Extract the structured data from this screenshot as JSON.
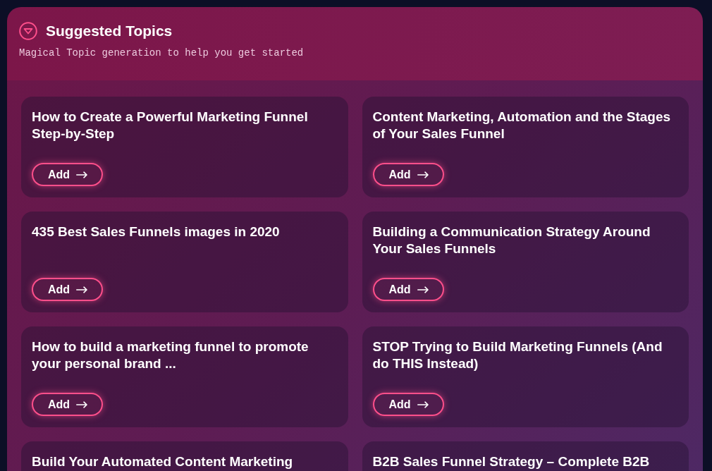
{
  "header": {
    "title": "Suggested Topics",
    "subtitle": "Magical Topic generation to help you get started"
  },
  "topics": [
    {
      "title": "How to Create a Powerful Marketing Funnel Step-by-Step",
      "button": "Add"
    },
    {
      "title": "Content Marketing, Automation and the Stages of Your Sales Funnel",
      "button": "Add"
    },
    {
      "title": "435 Best Sales Funnels images in 2020",
      "button": "Add"
    },
    {
      "title": "Building a Communication Strategy Around Your Sales Funnels",
      "button": "Add"
    },
    {
      "title": "How to build a marketing funnel to promote your personal brand ...",
      "button": "Add"
    },
    {
      "title": "STOP Trying to Build Marketing Funnels (And do THIS Instead)",
      "button": "Add"
    },
    {
      "title": "Build Your Automated Content Marketing"
    },
    {
      "title": "B2B Sales Funnel Strategy – Complete B2B"
    }
  ]
}
